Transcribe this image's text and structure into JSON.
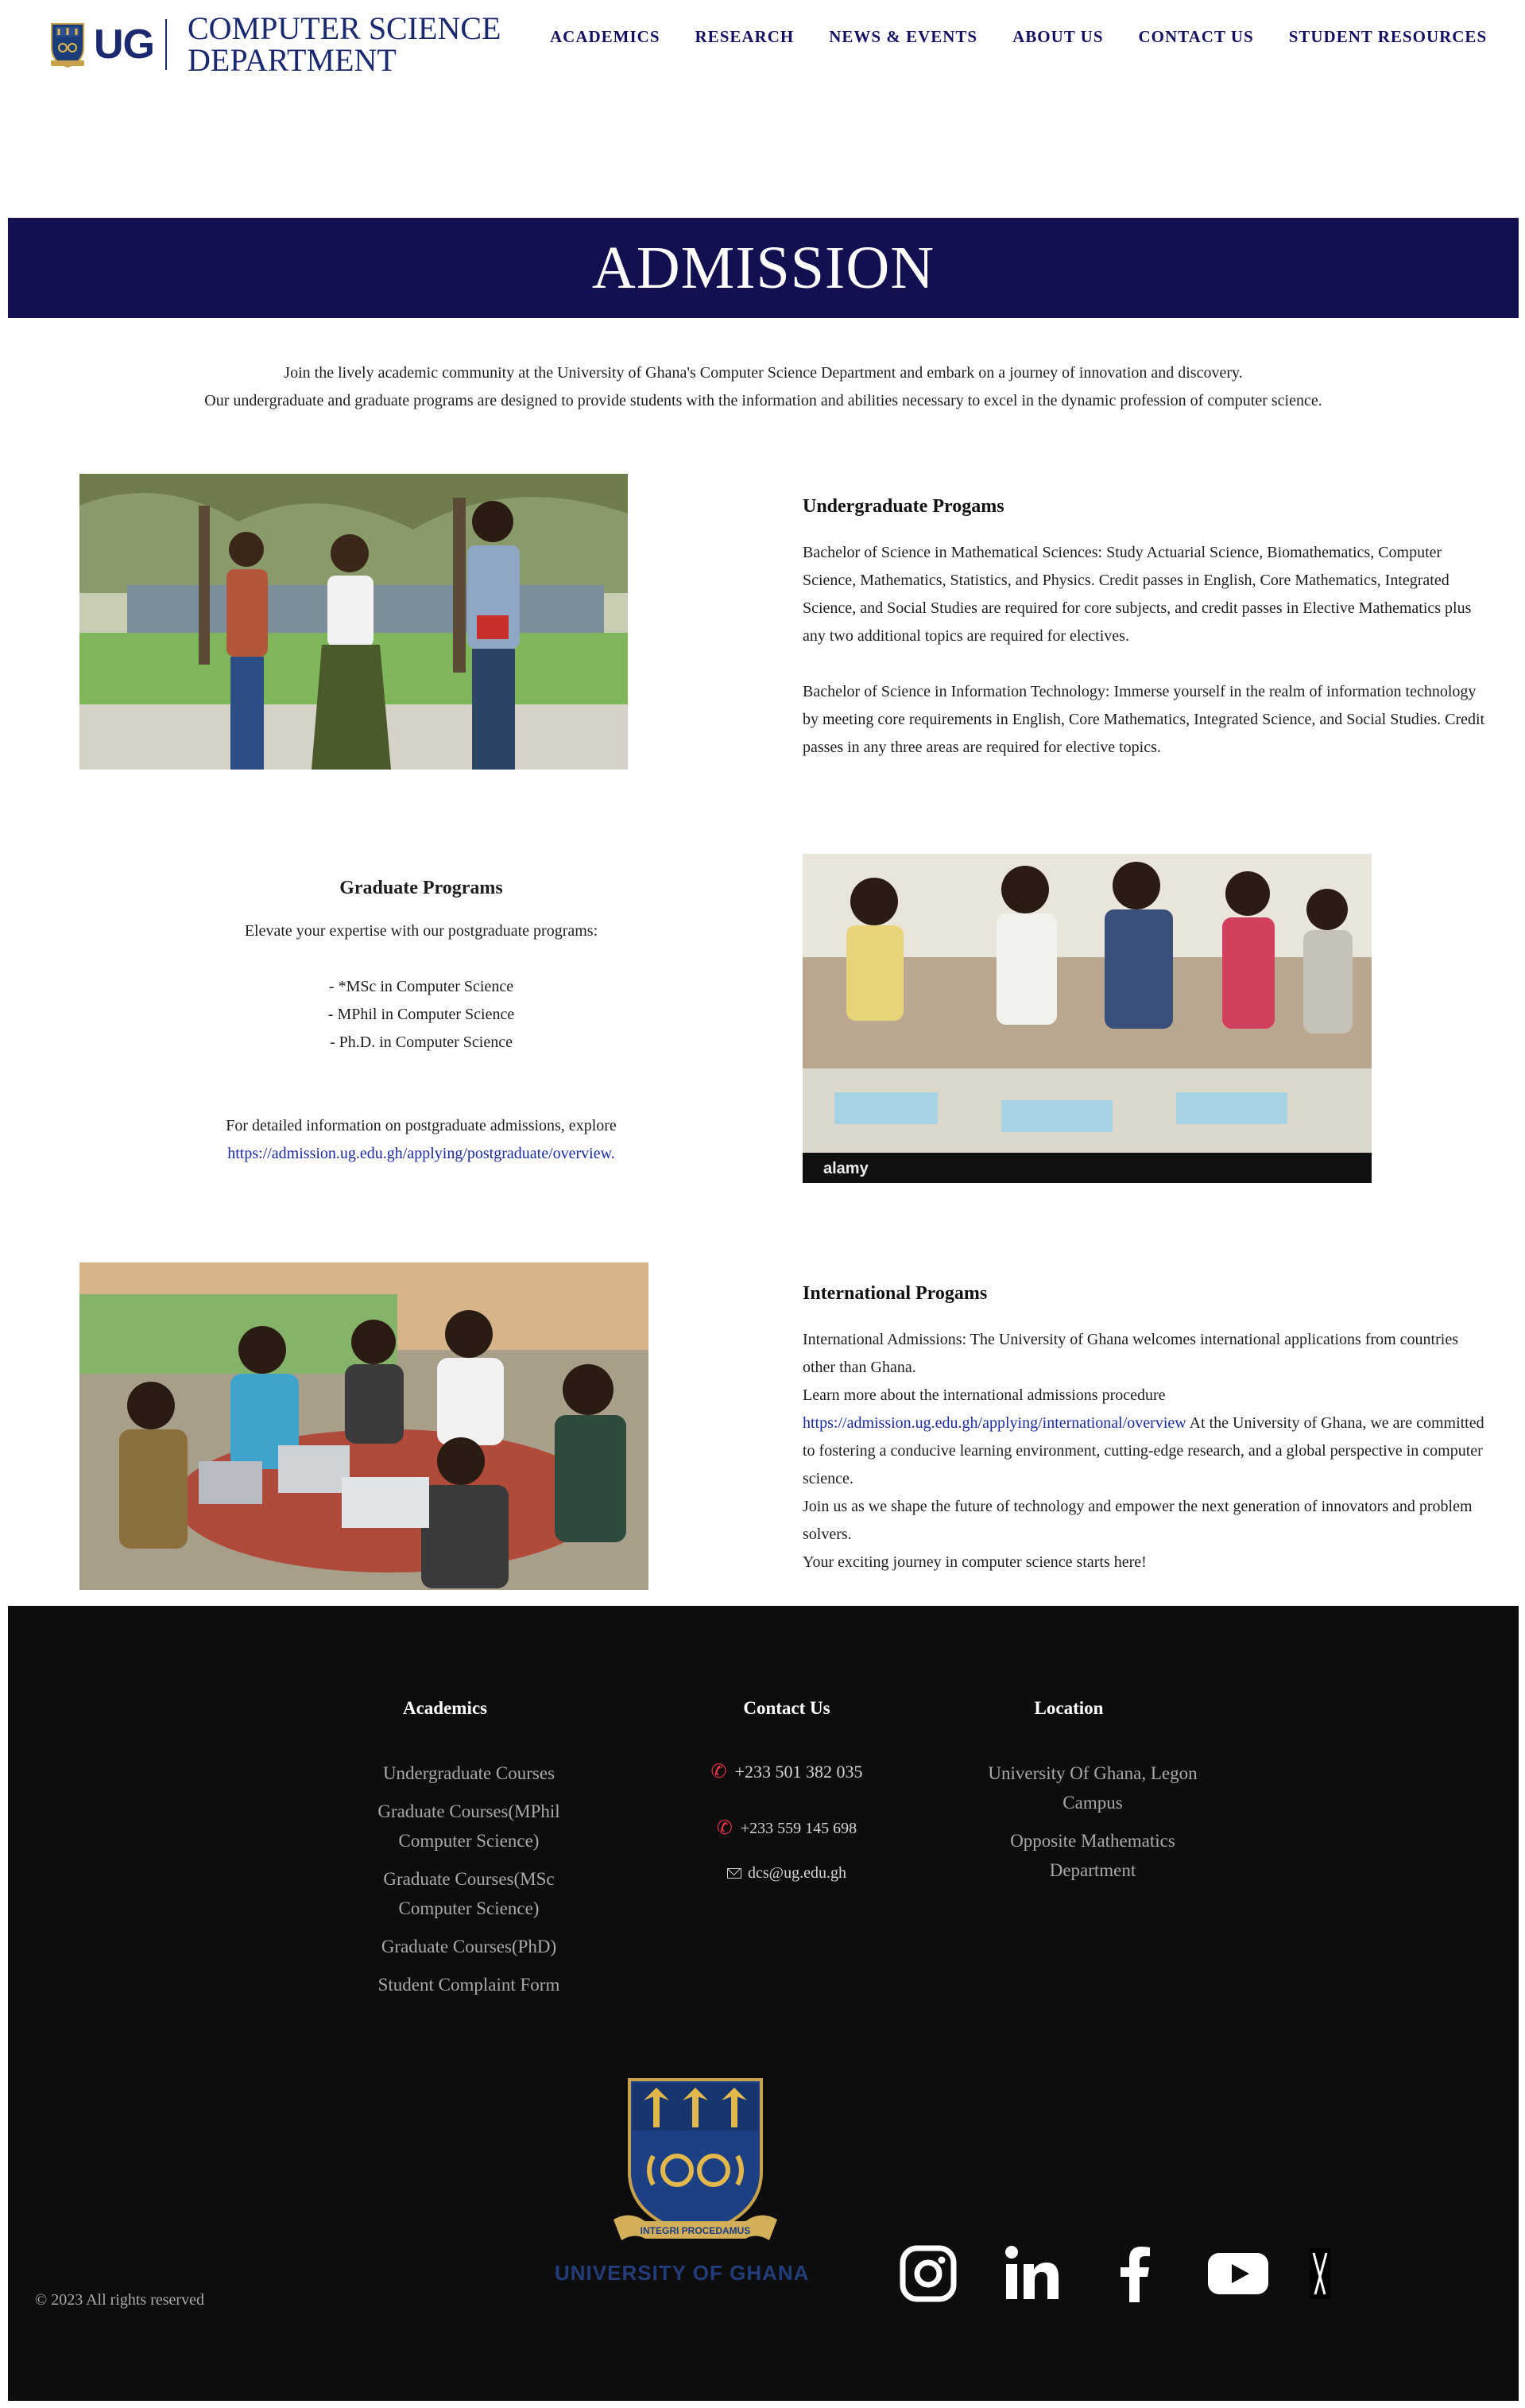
{
  "header": {
    "logo_mark": "UG",
    "logo_line1": "COMPUTER SCIENCE",
    "logo_line2": "DEPARTMENT",
    "nav": [
      "ACADEMICS",
      "RESEARCH",
      "NEWS & EVENTS",
      "ABOUT US",
      "CONTACT US",
      "STUDENT RESOURCES"
    ]
  },
  "hero": {
    "title": "ADMISSION"
  },
  "intro": {
    "line1": "Join the lively academic community at the University of Ghana's Computer Science Department and embark on a journey of innovation and discovery.",
    "line2": "Our undergraduate and graduate programs are designed to provide students with the information and abilities necessary to excel in the dynamic profession of computer science."
  },
  "undergraduate": {
    "title": "Undergraduate Progams",
    "para1": "Bachelor of Science in Mathematical Sciences: Study Actuarial Science, Biomathematics, Computer Science, Mathematics, Statistics, and Physics. Credit passes in English, Core Mathematics, Integrated Science, and Social Studies are required for core subjects, and credit passes in Elective Mathematics plus any two additional topics are required for electives.",
    "para2": "Bachelor of Science in Information Technology: Immerse yourself in the realm of information technology by meeting core requirements in English, Core Mathematics, Integrated Science, and Social Studies. Credit passes in any three areas are required for elective topics."
  },
  "graduate": {
    "title": "Graduate Programs",
    "lead": "Elevate your expertise with our postgraduate programs:",
    "programs": [
      "- *MSc in Computer Science",
      "- MPhil in Computer Science",
      "- Ph.D. in Computer Science"
    ],
    "detail_text": "For detailed information on postgraduate admissions, explore",
    "link": "https://admission.ug.edu.gh/applying/postgraduate/overview."
  },
  "international": {
    "title": "International Progams",
    "line1": "International Admissions: The University of Ghana welcomes international applications from countries other than Ghana.",
    "line2": "Learn more about the international admissions procedure",
    "link": "https://admission.ug.edu.gh/applying/international/overview",
    "line3": " At the University of Ghana, we are committed to fostering a conducive learning environment, cutting-edge research, and a global perspective in computer science.",
    "line4": "Join us as we shape the future of technology and empower the next generation of innovators and problem solvers.",
    "line5": "Your exciting journey in computer science starts here!"
  },
  "footer": {
    "academics": {
      "title": "Academics",
      "items": [
        "Undergraduate Courses",
        "Graduate Courses(MPhil Computer Science)",
        "Graduate Courses(MSc Computer Science)",
        "Graduate Courses(PhD)",
        "Student Complaint Form"
      ]
    },
    "contact": {
      "title": "Contact Us",
      "phone1": "+233 501 382 035",
      "phone2": "+233 559 145 698",
      "email": "dcs@ug.edu.gh"
    },
    "location": {
      "title": "Location",
      "items": [
        "University Of Ghana, Legon Campus",
        "Opposite Mathematics Department"
      ]
    },
    "copyright": "© 2023 All rights reserved",
    "university_name": "UNIVERSITY OF GHANA",
    "crest_motto": "INTEGRI PROCEDAMUS",
    "social": [
      "instagram-icon",
      "linkedin-icon",
      "facebook-icon",
      "youtube-icon",
      "x-icon"
    ]
  },
  "colors": {
    "navy": "#121050",
    "nav_text": "#141162",
    "footer_bg": "#0d0d0d",
    "link": "#1a2aa0",
    "phone_icon": "#e8334a"
  }
}
